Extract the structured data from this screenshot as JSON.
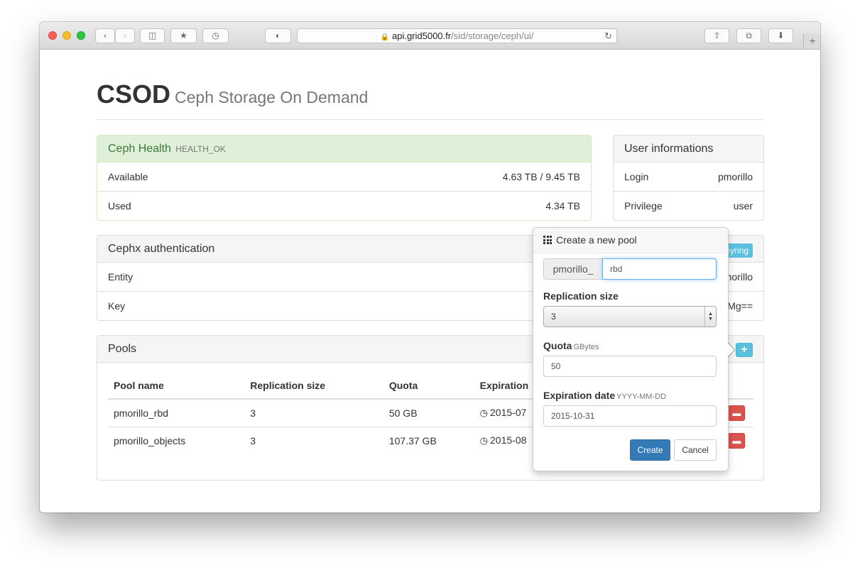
{
  "browser": {
    "url_host": "api.grid5000.fr",
    "url_path": "/sid/storage/ceph/ui/"
  },
  "header": {
    "title": "CSOD",
    "subtitle": "Ceph Storage On Demand"
  },
  "health": {
    "title": "Ceph Health",
    "status": "HEALTH_OK",
    "rows": [
      {
        "label": "Available",
        "value": "4.63 TB / 9.45 TB"
      },
      {
        "label": "Used",
        "value": "4.34 TB"
      }
    ]
  },
  "user": {
    "title": "User informations",
    "rows": [
      {
        "label": "Login",
        "value": "pmorillo"
      },
      {
        "label": "Privilege",
        "value": "user"
      }
    ]
  },
  "cephx": {
    "title": "Cephx authentication",
    "keyring_label": "Keyring",
    "rows": [
      {
        "label": "Entity",
        "value": "client.pmorillo"
      },
      {
        "label": "Key",
        "value": "AQBC…Mg=="
      }
    ]
  },
  "pools": {
    "title": "Pools",
    "add_icon": "plus-icon",
    "columns": [
      "Pool name",
      "Replication size",
      "Quota",
      "Expiration"
    ],
    "rows": [
      {
        "name": "pmorillo_rbd",
        "replication": "3",
        "quota": "50 GB",
        "expiration": "2015-07"
      },
      {
        "name": "pmorillo_objects",
        "replication": "3",
        "quota": "107.37 GB",
        "expiration": "2015-08"
      }
    ]
  },
  "popover": {
    "title": "Create a new pool",
    "prefix": "pmorillo_",
    "pool_name_value": "rbd",
    "replication_label": "Replication size",
    "replication_value": "3",
    "quota_label": "Quota",
    "quota_unit": "GBytes",
    "quota_value": "50",
    "expiration_label": "Expiration date",
    "expiration_format": "YYYY-MM-DD",
    "expiration_value": "2015-10-31",
    "create_label": "Create",
    "cancel_label": "Cancel"
  },
  "colors": {
    "health_bg": "#dff0d8",
    "health_text": "#3c763d",
    "info": "#5bc0de",
    "danger": "#d9534f",
    "primary": "#337ab7"
  }
}
